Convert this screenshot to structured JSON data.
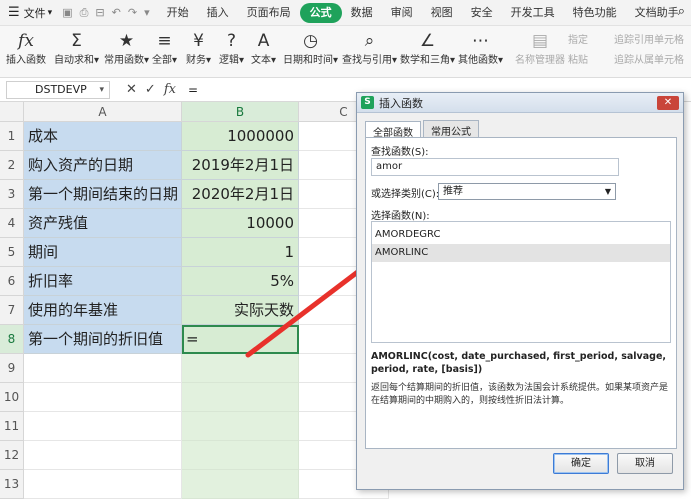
{
  "menubar": {
    "file_label": "文件",
    "tabs": [
      "开始",
      "插入",
      "页面布局",
      "公式",
      "数据",
      "审阅",
      "视图",
      "安全",
      "开发工具",
      "特色功能",
      "文档助手"
    ],
    "active_tab": "公式"
  },
  "toolbar": {
    "tools": [
      {
        "label": "插入函数",
        "icon": "fx"
      },
      {
        "label": "自动求和▾",
        "icon": "Σ"
      },
      {
        "label": "常用函数▾",
        "icon": "★"
      },
      {
        "label": "全部▾",
        "icon": "≡"
      },
      {
        "label": "财务▾",
        "icon": "¥"
      },
      {
        "label": "逻辑▾",
        "icon": "?"
      },
      {
        "label": "文本▾",
        "icon": "A"
      },
      {
        "label": "日期和时间▾",
        "icon": "◷"
      },
      {
        "label": "查找与引用▾",
        "icon": "⌕"
      },
      {
        "label": "数学和三角▾",
        "icon": "∠"
      },
      {
        "label": "其他函数▾",
        "icon": "⋯"
      },
      {
        "label": "名称管理器",
        "icon": "▤"
      }
    ],
    "small": [
      "指定",
      "粘贴",
      "追踪引用单元格",
      "追踪从属单元格"
    ]
  },
  "formula_bar": {
    "name_box": "DSTDEVP",
    "content": "="
  },
  "sheet": {
    "columns": [
      "A",
      "B",
      "C"
    ],
    "rows": [
      {
        "num": "1",
        "a": "成本",
        "b": "1000000"
      },
      {
        "num": "2",
        "a": "购入资产的日期",
        "b": "2019年2月1日"
      },
      {
        "num": "3",
        "a": "第一个期间结束的日期",
        "b": "2020年2月1日"
      },
      {
        "num": "4",
        "a": "资产残值",
        "b": "10000"
      },
      {
        "num": "5",
        "a": "期间",
        "b": "1"
      },
      {
        "num": "6",
        "a": "折旧率",
        "b": "5%"
      },
      {
        "num": "7",
        "a": "使用的年基准",
        "b": "实际天数"
      },
      {
        "num": "8",
        "a": "第一个期间的折旧值",
        "b": "="
      },
      {
        "num": "9",
        "a": "",
        "b": ""
      },
      {
        "num": "10",
        "a": "",
        "b": ""
      },
      {
        "num": "11",
        "a": "",
        "b": ""
      },
      {
        "num": "12",
        "a": "",
        "b": ""
      },
      {
        "num": "13",
        "a": "",
        "b": ""
      }
    ]
  },
  "dialog": {
    "title": "插入函数",
    "tab_all": "全部函数",
    "tab_common": "常用公式",
    "search_label": "查找函数(S):",
    "search_value": "amor",
    "category_label": "或选择类别(C):",
    "category_value": "推荐",
    "list_label": "选择函数(N):",
    "functions": [
      "AMORDEGRC",
      "AMORLINC"
    ],
    "selected_function": "AMORLINC",
    "signature": "AMORLINC(cost, date_purchased, first_period, salvage, period, rate, [basis])",
    "description": "返回每个结算期间的折旧值，该函数为法国会计系统提供。如果某项资产是在结算期间的中期购入的，则按线性折旧法计算。",
    "ok_label": "确定",
    "cancel_label": "取消"
  },
  "colors": {
    "accent": "#1fa25b",
    "col_a_fill": "#c7dbef",
    "col_b_fill": "#d7ecd3",
    "arrow": "#e8312b"
  }
}
